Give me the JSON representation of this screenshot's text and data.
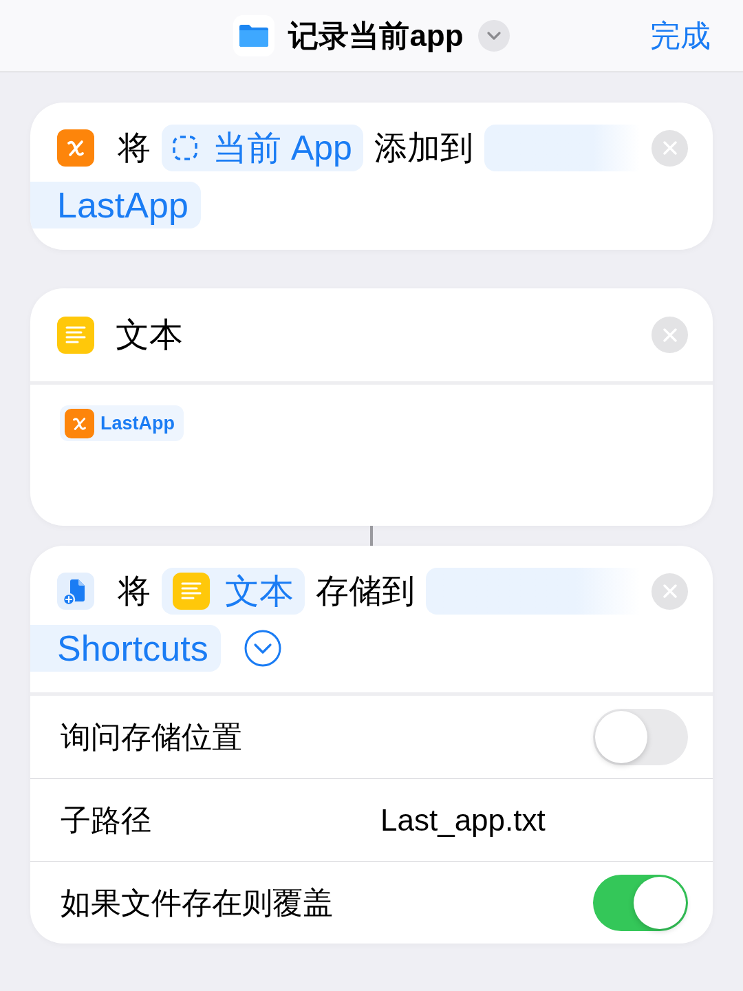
{
  "header": {
    "title": "记录当前app",
    "done": "完成"
  },
  "actions": [
    {
      "kind": "set_variable",
      "connected_to_previous": false,
      "parts": [
        {
          "kind": "text",
          "text": "将"
        },
        {
          "kind": "current_app",
          "text": "当前 App",
          "wrapped": false
        },
        {
          "kind": "text",
          "text": "添加到"
        },
        {
          "kind": "variable",
          "text": "LastApp",
          "wrapped": true
        }
      ]
    },
    {
      "kind": "text_block",
      "connected_to_previous": false,
      "title": "文本",
      "content": [
        {
          "kind": "variable",
          "text": "LastApp"
        }
      ]
    },
    {
      "kind": "save_file",
      "connected_to_previous": true,
      "parts": [
        {
          "kind": "text",
          "text": "将"
        },
        {
          "kind": "text_output",
          "text": "文本",
          "wrapped": false
        },
        {
          "kind": "text",
          "text": "存储到"
        },
        {
          "kind": "folder",
          "text": "Shortcuts",
          "wrapped": true
        },
        {
          "kind": "more"
        }
      ],
      "options": [
        {
          "kind": "toggle",
          "label": "询问存储位置",
          "on": false
        },
        {
          "kind": "value",
          "label": "子路径",
          "value": "Last_app.txt"
        },
        {
          "kind": "toggle",
          "label": "如果文件存在则覆盖",
          "on": true
        }
      ]
    }
  ]
}
